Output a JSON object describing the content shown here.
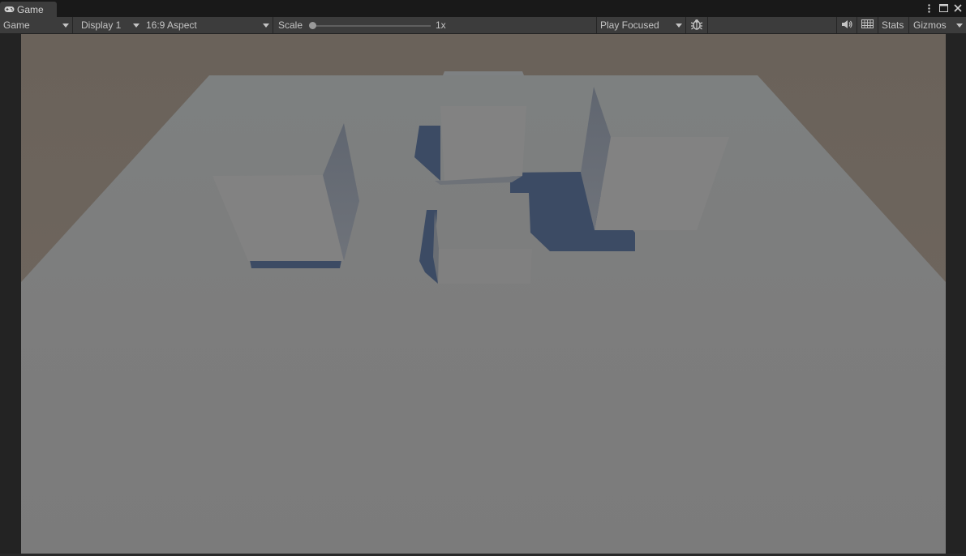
{
  "tab": {
    "title": "Game",
    "icon": "gamepad-icon"
  },
  "window_controls": {
    "menu_icon": "kebab-menu-icon",
    "maximize_icon": "maximize-icon",
    "close_icon": "close-icon"
  },
  "toolbar": {
    "view_mode": "Game",
    "display": "Display 1",
    "aspect": "16:9 Aspect",
    "scale_label": "Scale",
    "scale_value": "1x",
    "scale_level": 0,
    "play_mode": "Play Focused",
    "debug_icon": "bug-icon",
    "audio_icon": "speaker-icon",
    "stats_grid_icon": "grid-icon",
    "stats_label": "Stats",
    "gizmos_label": "Gizmos"
  },
  "colors": {
    "tab_bg": "#3c3c3c",
    "toolbar_bg": "#3c3c3c",
    "sky": "#6b635b",
    "floor": "#7b7b7b",
    "cube_face": "#828282",
    "cube_side": "#6b6f76",
    "shadow": "#3b4a65"
  }
}
